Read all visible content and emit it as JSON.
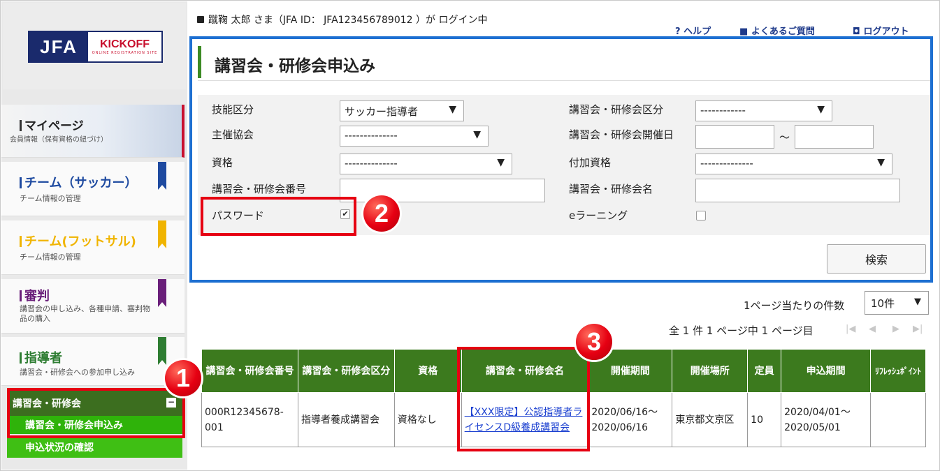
{
  "header": {
    "login_text": "蹴鞠 太郎 さま（JFA ID： JFA123456789012 ）が ログイン中",
    "help": "ヘルプ",
    "faq": "よくあるご質問",
    "logout": "ログアウト"
  },
  "logo": {
    "jfa": "JFA",
    "kickoff": "KICKOFF",
    "tagline": "ONLINE REGISTRATION SITE"
  },
  "sidebar": {
    "items": [
      {
        "title": "マイページ",
        "sub": "会員情報（保有資格の紐づけ）",
        "color": "#333333"
      },
      {
        "title": "チーム（サッカー）",
        "sub": "チーム情報の管理",
        "color": "#1e4aa0"
      },
      {
        "title": "チーム(フットサル)",
        "sub": "チーム情報の管理",
        "color": "#f0b400"
      },
      {
        "title": "審判",
        "sub": "講習会の申し込み、各種申請、審判物品の購入",
        "color": "#6a1f7a"
      },
      {
        "title": "指導者",
        "sub": "講習会・研修会への参加申し込み",
        "color": "#2e7d32"
      }
    ],
    "submenu": {
      "title": "講習会・研修会",
      "toggle": "−",
      "items": [
        "講習会・研修会申込み",
        "申込状況の確認"
      ]
    }
  },
  "panel": {
    "title": "講習会・研修会申込み",
    "labels": {
      "skill": "技能区分",
      "host": "主催協会",
      "license": "資格",
      "course_no": "講習会・研修会番号",
      "password": "パスワード",
      "course_type": "講習会・研修会区分",
      "course_date": "講習会・研修会開催日",
      "extra_license": "付加資格",
      "course_name": "講習会・研修会名",
      "elearning": "eラーニング"
    },
    "values": {
      "skill": "サッカー指導者",
      "host": "--------------",
      "license": "--------------",
      "course_type": "------------",
      "extra_license": "--------------",
      "date_sep": "～",
      "password_check": "✔"
    },
    "search_button": "検索"
  },
  "paging": {
    "per_page_label": "1ページ当たりの件数",
    "per_page_value": "10件",
    "info": "全 1 件 1 ページ中 1 ページ目"
  },
  "table": {
    "headers": [
      "講習会・研修会番号",
      "講習会・研修会区分",
      "資格",
      "講習会・研修会名",
      "開催期間",
      "開催場所",
      "定員",
      "申込期間",
      "ﾘﾌﾚｯｼｭﾎﾟｲﾝﾄ"
    ],
    "rows": [
      {
        "no": "000R12345678-001",
        "type": "指導者養成講習会",
        "license": "資格なし",
        "name": "【XXX限定】公認指導者ライセンスD級養成講習会",
        "period": "2020/06/16～2020/06/16",
        "place": "東京都文京区",
        "capacity": "10",
        "apply": "2020/04/01～2020/05/01",
        "refresh": ""
      }
    ]
  },
  "callouts": [
    "1",
    "2",
    "3"
  ],
  "colors": {
    "accent_blue": "#1d6fd1",
    "callout_red": "#e60012",
    "header_green": "#3c7a1e"
  }
}
